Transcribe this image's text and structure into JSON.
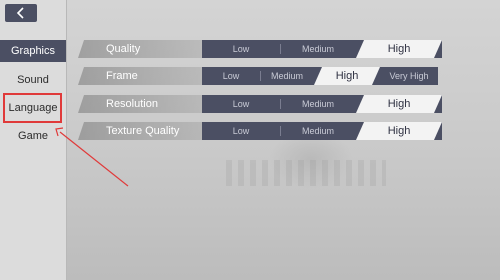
{
  "sidebar": {
    "items": [
      {
        "label": "Graphics",
        "active": true
      },
      {
        "label": "Sound",
        "active": false
      },
      {
        "label": "Language",
        "active": false
      },
      {
        "label": "Game",
        "active": false
      }
    ]
  },
  "back_button": {
    "icon": "chevron-left-icon"
  },
  "settings": [
    {
      "label": "Quality",
      "options": [
        "Low",
        "Medium",
        "High"
      ],
      "selected": "High"
    },
    {
      "label": "Frame",
      "options": [
        "Low",
        "Medium",
        "High",
        "Very High"
      ],
      "selected": "High"
    },
    {
      "label": "Resolution",
      "options": [
        "Low",
        "Medium",
        "High"
      ],
      "selected": "High"
    },
    {
      "label": "Texture Quality",
      "options": [
        "Low",
        "Medium",
        "High"
      ],
      "selected": "High"
    }
  ],
  "annotation": {
    "highlight_color": "#e03a3a"
  },
  "colors": {
    "accent": "#4b4f63",
    "selected": "#f3f3f3"
  }
}
